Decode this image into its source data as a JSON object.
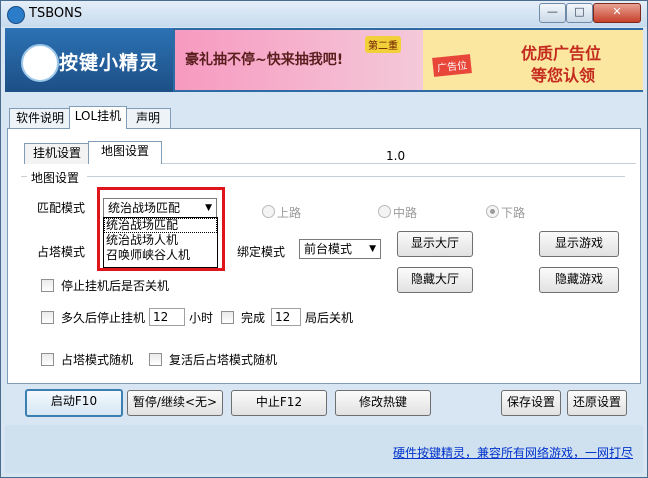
{
  "window": {
    "title": "TSBONS",
    "minimize": "—",
    "maximize": "□",
    "close": "✕"
  },
  "banner": {
    "logo_text": "按键小精灵",
    "ad1_text": "豪礼抽不停~快来抽我吧!",
    "ad1_badge": "第二重",
    "ad2_tag": "广告位",
    "ad2_line1": "优质广告位",
    "ad2_line2": "等您认领"
  },
  "top_tabs": [
    "软件说明",
    "LOL挂机",
    "声明"
  ],
  "inner_tabs": [
    "挂机设置",
    "地图设置"
  ],
  "version": "1.0",
  "map_group": {
    "title": "地图设置",
    "match_mode_label": "匹配模式",
    "match_mode_value": "统治战场匹配",
    "dropdown_options": [
      "统治战场匹配",
      "统治战场人机",
      "召唤师峡谷人机"
    ],
    "lane_top": "上路",
    "lane_mid": "中路",
    "lane_bottom": "下路",
    "tower_mode_label": "占塔模式",
    "bind_mode_label": "绑定模式",
    "bind_mode_value": "前台模式",
    "show_hall": "显示大厅",
    "hide_hall": "隐藏大厅",
    "show_game": "显示游戏",
    "hide_game": "隐藏游戏"
  },
  "options": {
    "shutdown_after_stop": "停止挂机后是否关机",
    "stop_after_prefix": "多久后停止挂机",
    "stop_after_value": "12",
    "stop_after_unit": "小时",
    "finish_prefix": "完成",
    "finish_value": "12",
    "finish_suffix": "局后关机",
    "random_tower": "占塔模式随机",
    "revive_random_tower": "复活后占塔模式随机"
  },
  "buttons": {
    "start": "启动F10",
    "pause": "暂停/继续<无>",
    "stop": "中止F12",
    "hotkey": "修改热键",
    "save": "保存设置",
    "restore": "还原设置"
  },
  "footer": {
    "link": "硬件按键精灵，兼容所有网络游戏，一网打尽"
  },
  "colors": {
    "highlight_box": "#e0151b",
    "link": "#0033cc"
  }
}
